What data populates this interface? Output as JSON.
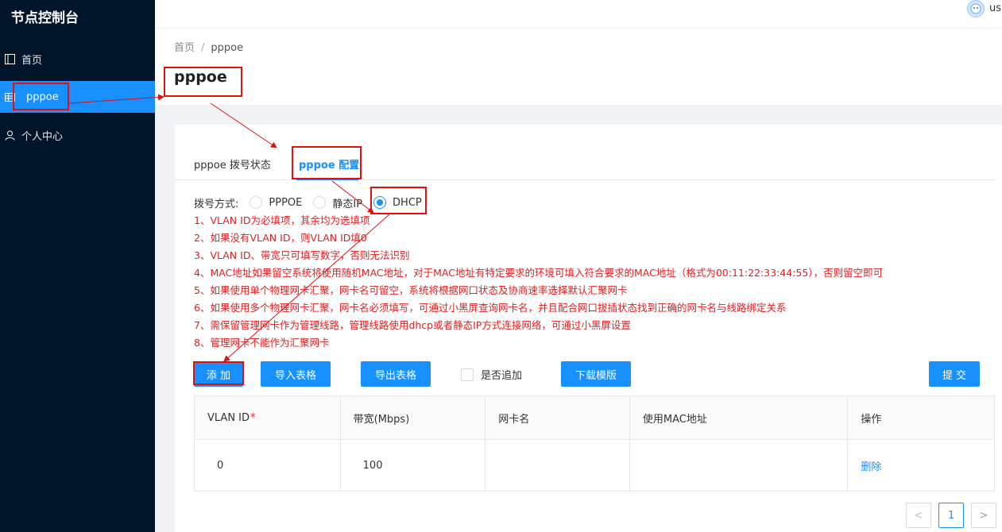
{
  "sidebar": {
    "brand": "节点控制台",
    "items": [
      {
        "label": "首页",
        "icon": "layout-icon"
      },
      {
        "label": "pppoe",
        "icon": "table-icon",
        "active": true
      },
      {
        "label": "个人中心",
        "icon": "user-icon"
      }
    ]
  },
  "header": {
    "username": "us",
    "breadcrumb": [
      "首页",
      "/",
      "pppoe"
    ],
    "title": "pppoe"
  },
  "tabs": [
    "pppoe 拨号状态",
    "pppoe 配置"
  ],
  "dial": {
    "label": "拨号方式:",
    "options": [
      "PPPOE",
      "静态IP",
      "DHCP"
    ],
    "selected": "DHCP"
  },
  "notes": [
    "1、VLAN ID为必填项，其余均为选填项",
    "2、如果没有VLAN ID，则VLAN ID填0",
    "3、VLAN ID、带宽只可填写数字，否则无法识别",
    "4、MAC地址如果留空系统将使用随机MAC地址，对于MAC地址有特定要求的环境可填入符合要求的MAC地址（格式为00:11:22:33:44:55），否则留空即可",
    "5、如果使用单个物理网卡汇聚，网卡名可留空，系统将根据网口状态及协商速率选择默认汇聚网卡",
    "6、如果使用多个物理网卡汇聚，网卡名必须填写，可通过小黑屏查询网卡名，并且配合网口拔插状态找到正确的网卡名与线路绑定关系",
    "7、需保留管理网卡作为管理线路，管理线路使用dhcp或者静态IP方式连接网络，可通过小黑屏设置",
    "8、管理网卡不能作为汇聚网卡"
  ],
  "toolbar": {
    "add": "添 加",
    "import": "导入表格",
    "export": "导出表格",
    "append": "是否追加",
    "template": "下载模版",
    "submit": "提 交"
  },
  "table": {
    "columns": [
      "VLAN ID",
      "带宽(Mbps)",
      "网卡名",
      "使用MAC地址",
      "操作"
    ],
    "required_mark": "*",
    "rows": [
      {
        "vlan": "0",
        "bandwidth": "100",
        "nic": "",
        "mac": "",
        "action": "删除"
      }
    ]
  },
  "pagination": {
    "prev": "<",
    "page": "1",
    "next": ">"
  },
  "colors": {
    "primary": "#1890ff",
    "sidebar": "#001529",
    "note": "#e02020",
    "annotation": "#e01010"
  }
}
